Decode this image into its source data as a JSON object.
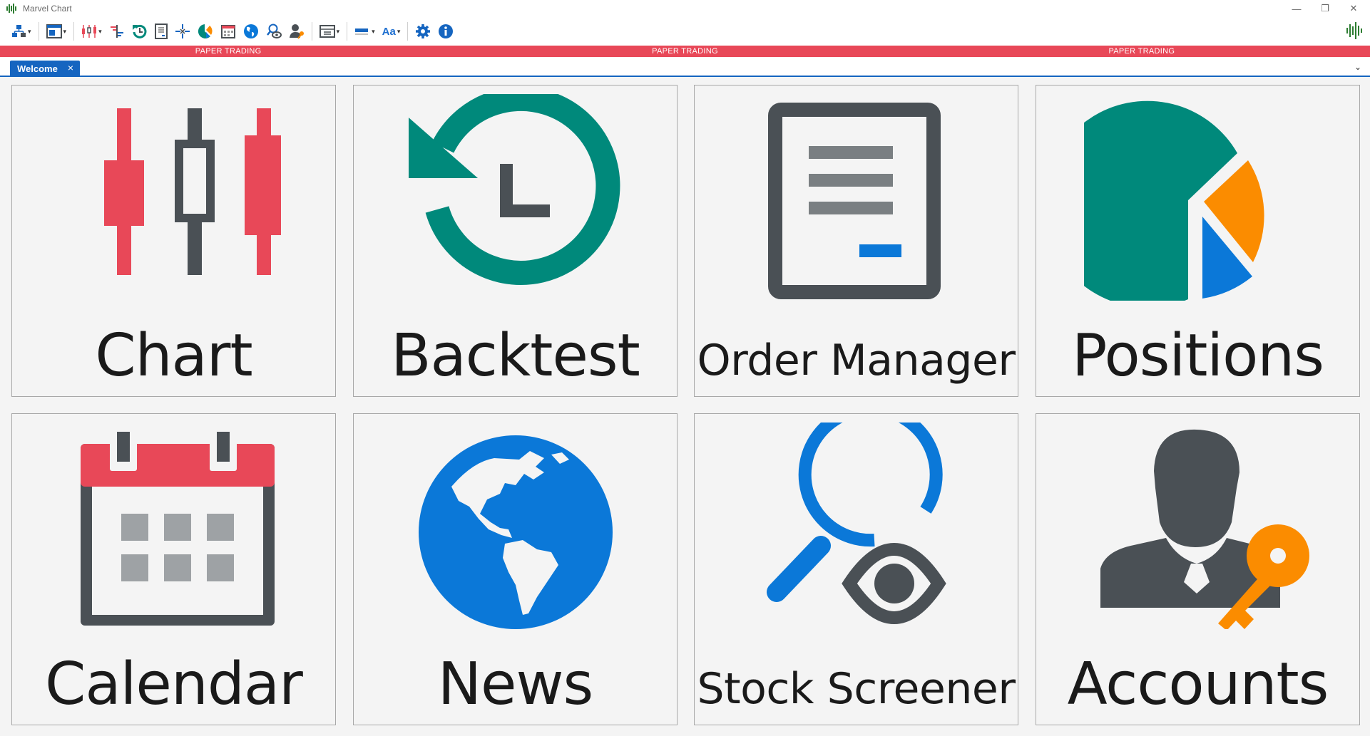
{
  "window": {
    "title": "Marvel Chart",
    "controls": [
      "minimize",
      "restore",
      "close"
    ]
  },
  "toolbar": {
    "buttons": [
      {
        "name": "workspace-layout-icon",
        "has_dropdown": true
      },
      {
        "name": "window-layout-icon",
        "has_dropdown": true
      },
      {
        "name": "candlestick-chart-icon",
        "has_dropdown": true
      },
      {
        "name": "depth-of-market-icon"
      },
      {
        "name": "backtest-icon"
      },
      {
        "name": "order-manager-icon"
      },
      {
        "name": "crosshair-icon"
      },
      {
        "name": "positions-icon"
      },
      {
        "name": "calendar-icon"
      },
      {
        "name": "news-globe-icon"
      },
      {
        "name": "stock-screener-icon"
      },
      {
        "name": "accounts-icon"
      },
      {
        "name": "template-icon",
        "has_dropdown": true
      },
      {
        "name": "color-theme-icon",
        "has_dropdown": true
      },
      {
        "name": "font-size-icon",
        "has_dropdown": true
      },
      {
        "name": "settings-gear-icon"
      },
      {
        "name": "info-icon"
      }
    ],
    "font_label": "Aa",
    "status_icon": "connection-status-icon"
  },
  "banner": {
    "items": [
      "PAPER TRADING",
      "PAPER TRADING",
      "PAPER TRADING"
    ],
    "color": "#e84858"
  },
  "tabs": [
    {
      "label": "Welcome",
      "close": "×",
      "active": true
    }
  ],
  "tab_menu_glyph": "⌄",
  "tiles": [
    {
      "label": "Chart",
      "icon": "candlestick-chart-icon"
    },
    {
      "label": "Backtest",
      "icon": "backtest-history-icon"
    },
    {
      "label": "Order Manager",
      "icon": "order-document-icon"
    },
    {
      "label": "Positions",
      "icon": "pie-chart-icon"
    },
    {
      "label": "Calendar",
      "icon": "calendar-icon"
    },
    {
      "label": "News",
      "icon": "globe-icon"
    },
    {
      "label": "Stock Screener",
      "icon": "magnifier-eye-icon"
    },
    {
      "label": "Accounts",
      "icon": "user-key-icon"
    }
  ],
  "colors": {
    "accent_blue": "#1565c0",
    "chart_red": "#e84858",
    "teal": "#00897b",
    "orange": "#fb8c00",
    "dark_gray": "#4a5055",
    "blue": "#0b78d8"
  }
}
